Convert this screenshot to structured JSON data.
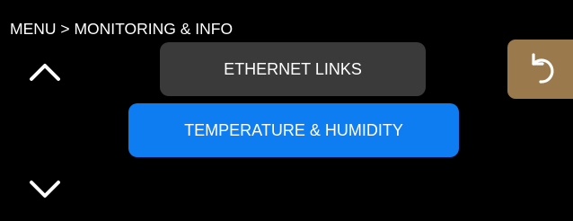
{
  "header": {
    "breadcrumb": "MENU > MONITORING & INFO"
  },
  "navigation": {
    "up_icon": "chevron-up-icon",
    "down_icon": "chevron-down-icon"
  },
  "menu": {
    "items": [
      {
        "label": "ETHERNET LINKS",
        "selected": false
      },
      {
        "label": "TEMPERATURE & HUMIDITY",
        "selected": true
      }
    ]
  },
  "back": {
    "icon": "back-arrow-icon"
  },
  "colors": {
    "background": "#000000",
    "item_default": "#3a3a3a",
    "item_selected": "#0f7df2",
    "back_button": "#9a7a4c",
    "text": "#ffffff"
  }
}
